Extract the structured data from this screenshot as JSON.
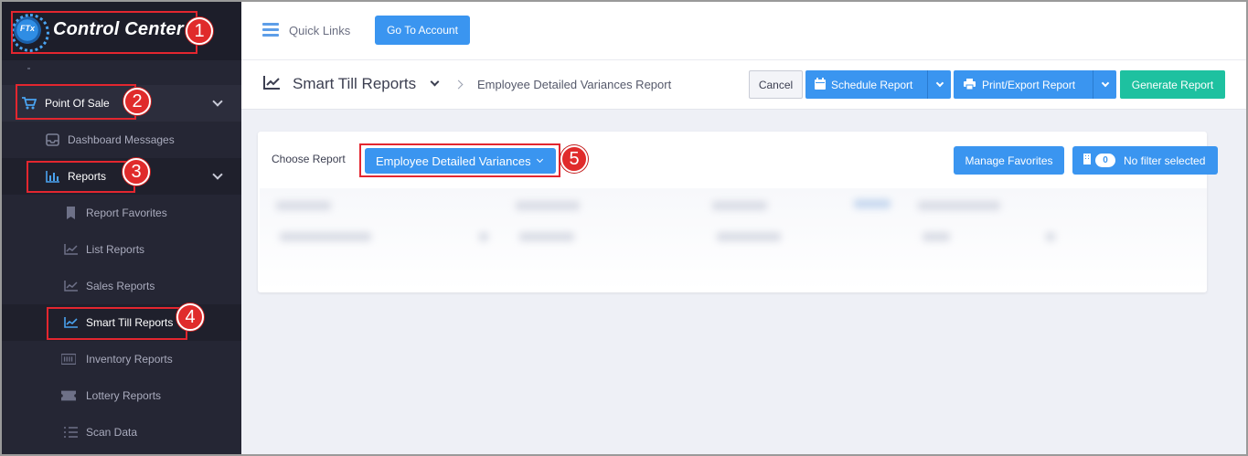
{
  "brand": {
    "logo_text": "FTx",
    "title": "Control Center"
  },
  "sidebar": {
    "point_of_sale": "Point Of Sale",
    "dashboard_messages": "Dashboard Messages",
    "reports": "Reports",
    "items": [
      {
        "label": "Report Favorites",
        "icon": "bookmark-icon"
      },
      {
        "label": "List Reports",
        "icon": "chart-line-icon"
      },
      {
        "label": "Sales Reports",
        "icon": "chart-line-icon"
      },
      {
        "label": "Smart Till Reports",
        "icon": "chart-line-icon"
      },
      {
        "label": "Inventory Reports",
        "icon": "barcode-icon"
      },
      {
        "label": "Lottery Reports",
        "icon": "ticket-icon"
      },
      {
        "label": "Scan Data",
        "icon": "list-icon"
      }
    ]
  },
  "topbar": {
    "quick_links": "Quick Links",
    "go_to_account": "Go To Account"
  },
  "subheader": {
    "title": "Smart Till Reports",
    "breadcrumb": "Employee Detailed Variances Report",
    "cancel": "Cancel",
    "schedule": "Schedule Report",
    "print_export": "Print/Export Report",
    "generate": "Generate Report"
  },
  "card": {
    "choose_report": "Choose Report",
    "selected_report": "Employee Detailed Variances",
    "manage_favorites": "Manage Favorites",
    "filter_count": "0",
    "filter_text": "No filter selected"
  },
  "callouts": [
    "1",
    "2",
    "3",
    "4",
    "5"
  ],
  "colors": {
    "sidebar": "#252634",
    "primary": "#3a95f0",
    "success": "#1ec1a0",
    "callout": "#e3262f"
  }
}
